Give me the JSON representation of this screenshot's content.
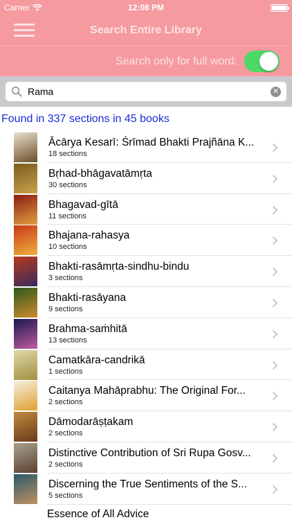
{
  "status": {
    "carrier": "Carrier",
    "time": "12:08 PM"
  },
  "nav": {
    "title": "Search Entire Library"
  },
  "toggle": {
    "label": "Search only for full word:",
    "on": true
  },
  "search": {
    "value": "Rama"
  },
  "summary": "Found in 337 sections in 45 books",
  "colors": {
    "brand": "#f59a9f",
    "switch_on": "#4cd964",
    "summary_text": "#1a2bd6"
  },
  "books": [
    {
      "title": "Ācārya Kesarī: Śrīmad Bhakti Prajñāna K...",
      "sections": "18 sections",
      "cover": [
        "#e8e0cc",
        "#6b4f2a"
      ]
    },
    {
      "title": "Bṛhad-bhāgavatāmṛta",
      "sections": "30 sections",
      "cover": [
        "#7a5a1e",
        "#c9a44a"
      ]
    },
    {
      "title": "Bhagavad-gītā",
      "sections": "11 sections",
      "cover": [
        "#8b1d12",
        "#e0a040"
      ]
    },
    {
      "title": "Bhajana-rahasya",
      "sections": "10 sections",
      "cover": [
        "#c83a16",
        "#f0b040"
      ]
    },
    {
      "title": "Bhakti-rasāmṛta-sindhu-bindu",
      "sections": "3 sections",
      "cover": [
        "#b83a1a",
        "#3a2a60"
      ]
    },
    {
      "title": "Bhakti-rasāyana",
      "sections": "9 sections",
      "cover": [
        "#2c5a1a",
        "#d08a30"
      ]
    },
    {
      "title": "Brahma-saṁhitā",
      "sections": "13 sections",
      "cover": [
        "#1a1a50",
        "#c05aa0"
      ]
    },
    {
      "title": "Camatkāra-candrikā",
      "sections": "1 sections",
      "cover": [
        "#e0d8a8",
        "#a09040"
      ]
    },
    {
      "title": "Caitanya Mahāprabhu: The Original For...",
      "sections": "2 sections",
      "cover": [
        "#f4f0e0",
        "#e0a030"
      ]
    },
    {
      "title": "Dāmodarāṣṭakam",
      "sections": "2 sections",
      "cover": [
        "#c08a40",
        "#6a3a1a"
      ]
    },
    {
      "title": "Distinctive Contribution of Sri Rupa Gosv...",
      "sections": "2 sections",
      "cover": [
        "#a8a090",
        "#5a4030"
      ]
    },
    {
      "title": "Discerning the True Sentiments of the S...",
      "sections": "5 sections",
      "cover": [
        "#2a5a6a",
        "#c09060"
      ]
    },
    {
      "title": "Essence of All Advice",
      "sections": "",
      "cover": [
        "#d8c8a0",
        "#8a6a40"
      ]
    }
  ]
}
